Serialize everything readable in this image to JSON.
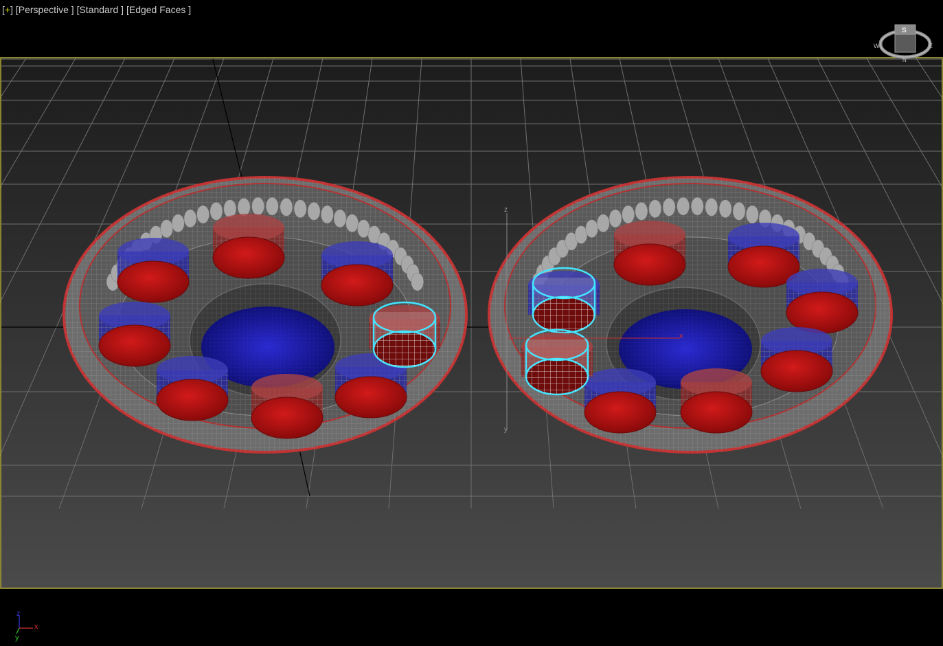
{
  "viewport": {
    "menu_label": "+",
    "view_label": "Perspective",
    "shading_label": "Standard",
    "display_label": "Edged Faces",
    "active_border_color": "#b5ae3a",
    "background_top": "#1f1f1f",
    "background_bottom": "#474747"
  },
  "viewcube": {
    "top_label": "S",
    "compass": {
      "west": "W",
      "east": "E",
      "north": "N"
    }
  },
  "gizmo": {
    "z_label": "z",
    "x_label": "x",
    "y_label": "y"
  },
  "axis_tripod": {
    "z_label": "z",
    "x_label": "x",
    "y_label": "y"
  },
  "colors": {
    "roller_red": "#b51515",
    "race_blue": "#1a1aa8",
    "selection": "#44e4ff",
    "wire": "#c9c9c9"
  }
}
